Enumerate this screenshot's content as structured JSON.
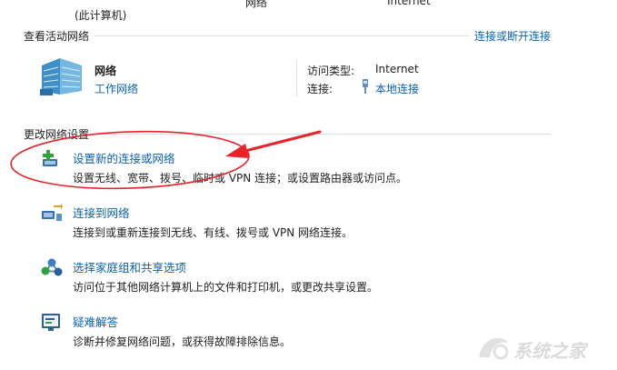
{
  "top_row": {
    "partial_left": "(此计算机)",
    "partial_mid": "网络",
    "partial_right": "Internet"
  },
  "active_networks": {
    "section_title": "查看活动网络",
    "connect_link": "连接或断开连接",
    "network_name": "网络",
    "network_type": "工作网络",
    "access_type_label": "访问类型:",
    "access_type_value": "Internet",
    "connections_label": "连接:",
    "connections_value": "本地连接"
  },
  "change_settings": {
    "section_title": "更改网络设置",
    "tasks": [
      {
        "icon": "new-connection-icon",
        "title": "设置新的连接或网络",
        "desc": "设置无线、宽带、拨号、临时或 VPN 连接；或设置路由器或访问点。"
      },
      {
        "icon": "connect-network-icon",
        "title": "连接到网络",
        "desc": "连接到或重新连接到无线、有线、拨号或 VPN 网络连接。"
      },
      {
        "icon": "homegroup-icon",
        "title": "选择家庭组和共享选项",
        "desc": "访问位于其他网络计算机上的文件和打印机，或更改共享设置。"
      },
      {
        "icon": "troubleshoot-icon",
        "title": "疑难解答",
        "desc": "诊断并修复网络问题，或获得故障排除信息。"
      }
    ]
  },
  "watermark": {
    "text": "系统之家"
  },
  "colors": {
    "link": "#0b62b0",
    "annotation": "#e8242a",
    "rule": "#d5dfe5"
  }
}
